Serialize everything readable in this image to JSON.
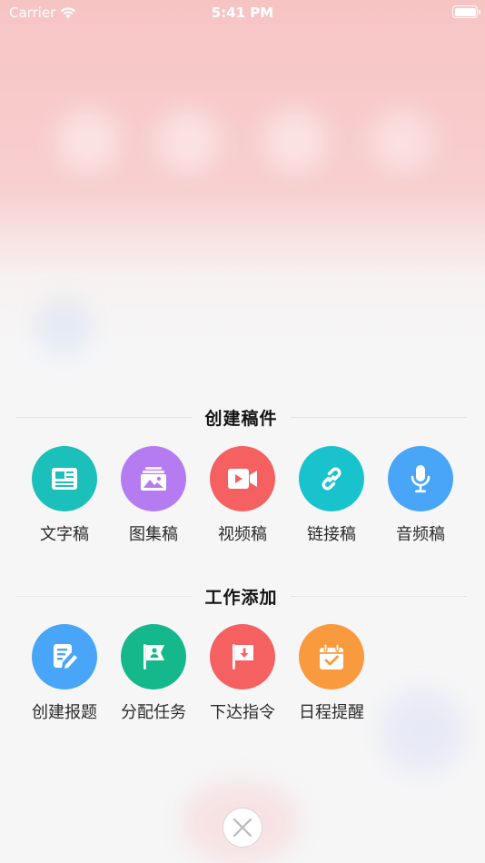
{
  "status_bar": {
    "carrier": "Carrier",
    "time": "5:41 PM"
  },
  "create_section": {
    "title": "创建稿件",
    "items": [
      {
        "label": "文字稿",
        "icon": "text-document-icon",
        "color": "#1cc0bb"
      },
      {
        "label": "图集稿",
        "icon": "gallery-icon",
        "color": "#b57cf2"
      },
      {
        "label": "视频稿",
        "icon": "video-icon",
        "color": "#f56161"
      },
      {
        "label": "链接稿",
        "icon": "link-icon",
        "color": "#19c3cd"
      },
      {
        "label": "音频稿",
        "icon": "microphone-icon",
        "color": "#48a5f7"
      }
    ]
  },
  "work_section": {
    "title": "工作添加",
    "items": [
      {
        "label": "创建报题",
        "icon": "edit-document-icon",
        "color": "#48a5f7"
      },
      {
        "label": "分配任务",
        "icon": "flag-person-icon",
        "color": "#14b88a"
      },
      {
        "label": "下达指令",
        "icon": "flag-download-icon",
        "color": "#f56161"
      },
      {
        "label": "日程提醒",
        "icon": "calendar-check-icon",
        "color": "#fa9a3e"
      }
    ]
  },
  "close_button": {
    "icon": "close-icon"
  }
}
